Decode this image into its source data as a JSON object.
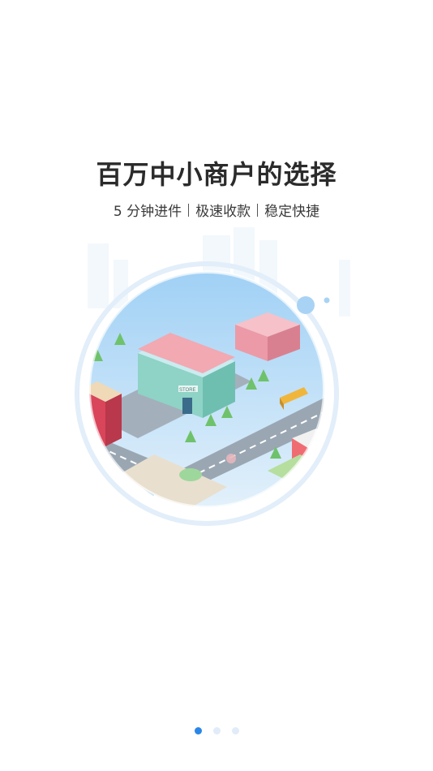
{
  "onboarding": {
    "headline": "百万中小商户的选择",
    "features": [
      "5 分钟进件",
      "极速收款",
      "稳定快捷"
    ],
    "illustration_icon": "city-store-illustration",
    "store_sign": "STORE"
  },
  "pager": {
    "active_index": 0,
    "count": 3,
    "active_color": "#2a86e8",
    "inactive_color": "#e1ecf9"
  }
}
